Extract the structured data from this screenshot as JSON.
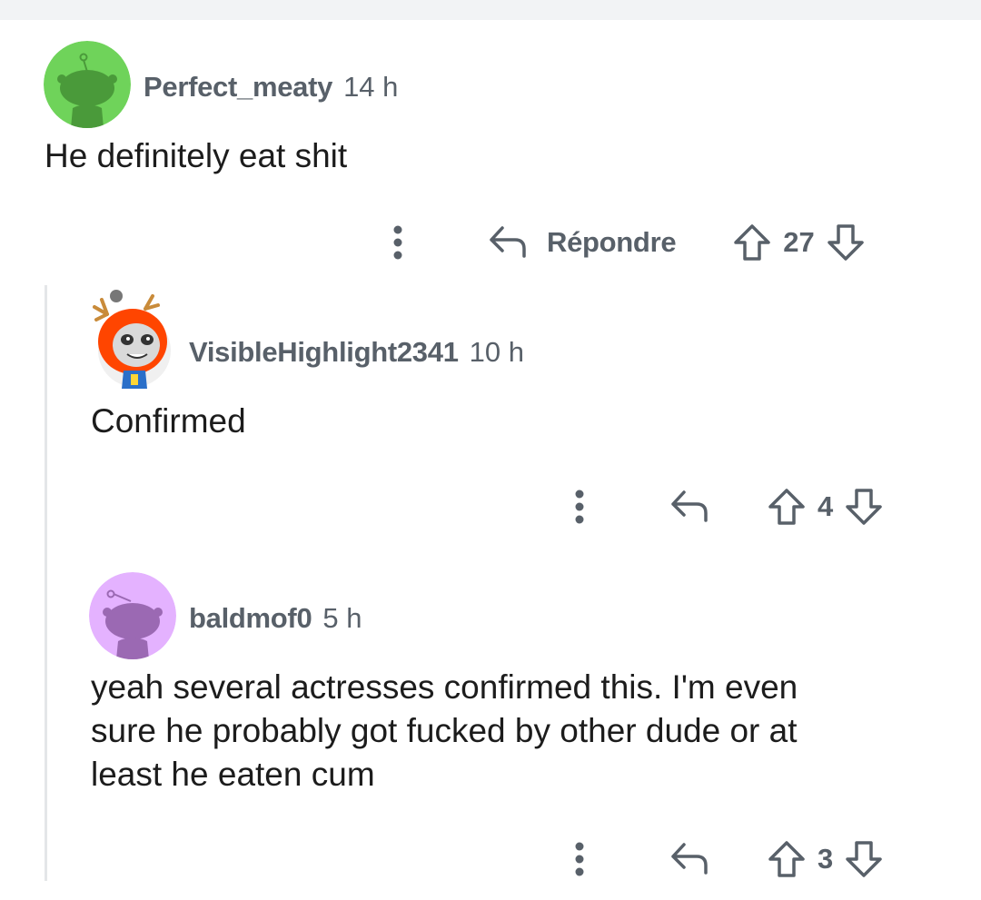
{
  "comments": [
    {
      "username": "Perfect_meaty",
      "time": "14 h",
      "body": "He definitely eat shit",
      "avatar": {
        "kind": "snoo",
        "bg": "#6fd35a",
        "fg": "#4a9a3a"
      },
      "reply_label": "Répondre",
      "score": "27"
    },
    {
      "username": "VisibleHighlight2341",
      "time": "10 h",
      "body": "Confirmed",
      "avatar": {
        "kind": "custom-raccoon",
        "bg": "#f5f5f5",
        "fg": "#ff4500"
      },
      "reply_label": "",
      "score": "4"
    },
    {
      "username": "baldmof0",
      "time": "5 h",
      "body": "yeah several actresses confirmed this. I'm even\nsure he probably got fucked by other dude or at\nleast he eaten cum",
      "avatar": {
        "kind": "snoo",
        "bg": "#e4b2ff",
        "fg": "#9b69b3"
      },
      "reply_label": "",
      "score": "3"
    }
  ],
  "colors": {
    "meta_gray": "#586069",
    "thread_line": "#e4e6e8",
    "top_bar": "#f2f3f5"
  },
  "icons": [
    "more-options-icon",
    "reply-arrow-icon",
    "upvote-arrow-icon",
    "downvote-arrow-icon"
  ]
}
